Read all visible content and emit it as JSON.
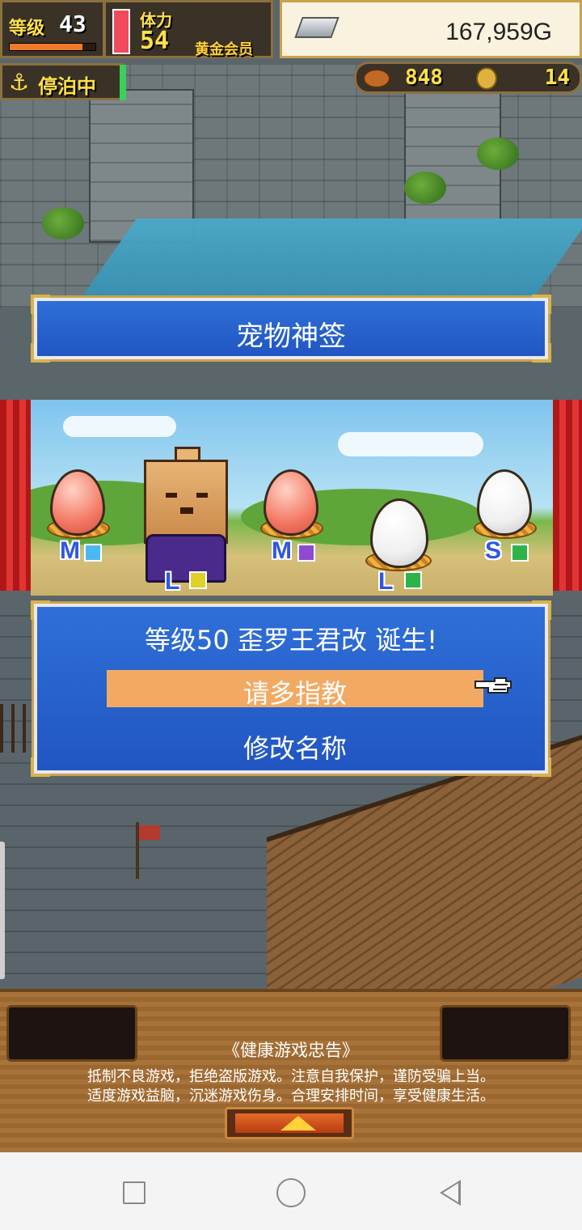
{
  "hud": {
    "level_label": "等级",
    "level_value": "43",
    "exp_progress": 0.85,
    "stamina_label": "体力",
    "stamina_value": "54",
    "member_label": "黄金会员",
    "gold_value": "167,959G",
    "status_label": "停泊中",
    "food_value": "848",
    "medal_value": "14"
  },
  "title_panel": {
    "title": "宠物神签"
  },
  "showcase": {
    "eggs": [
      {
        "size": "M",
        "color": "red",
        "element": "water"
      },
      {
        "size": "L",
        "color": "pet",
        "element": "thunder"
      },
      {
        "size": "M",
        "color": "red",
        "element": "dark"
      },
      {
        "size": "L",
        "color": "white",
        "element": "grass"
      },
      {
        "size": "S",
        "color": "white",
        "element": "grass"
      }
    ]
  },
  "birth_dialog": {
    "message": "等级50 歪罗王君改 诞生!",
    "greet_label": "请多指教",
    "rename_label": "修改名称"
  },
  "notice": {
    "title": "《健康游戏忠告》",
    "line1": "抵制不良游戏，拒绝盗版游戏。注意自我保护，谨防受骗上当。",
    "line2": "适度游戏益脑，沉迷游戏伤身。合理安排时间，享受健康生活。"
  },
  "colors": {
    "dialog_blue": "#2f6fd8",
    "highlight_orange": "#f2aa63",
    "size_label_blue": "#2f57e0"
  },
  "icons": [
    "anchor-icon",
    "meat-icon",
    "medal-icon",
    "silver-bar-icon",
    "hand-pointer-icon",
    "arrow-up-icon"
  ]
}
